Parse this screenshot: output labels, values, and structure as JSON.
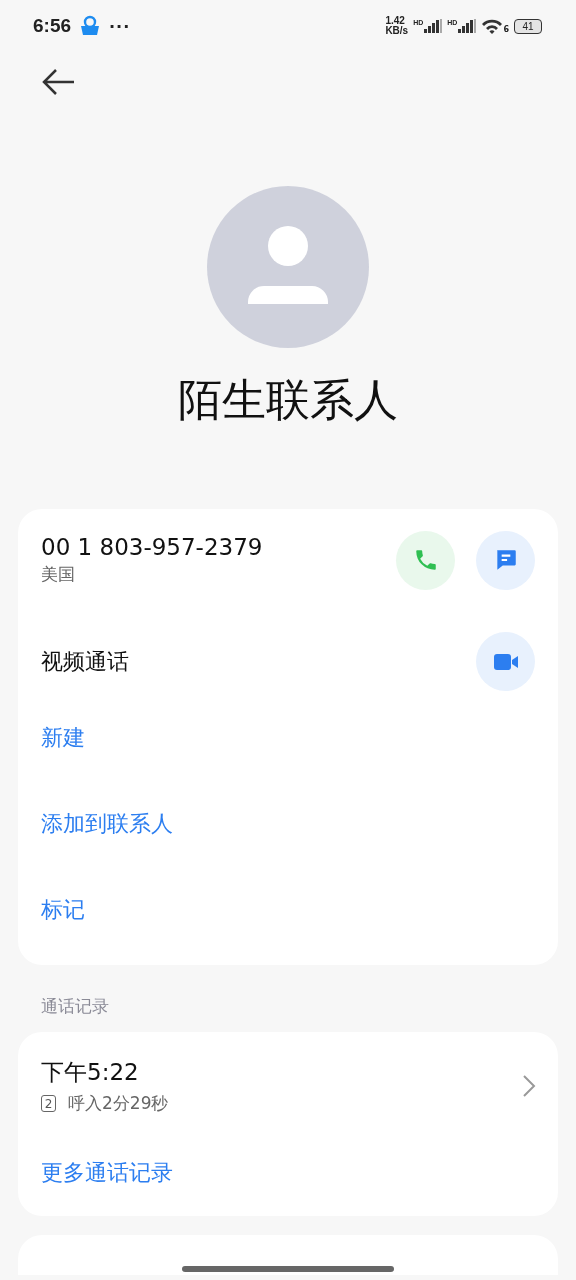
{
  "status_bar": {
    "time": "6:56",
    "more": "···",
    "net_speed": [
      "1.42",
      "KB/s"
    ],
    "signals": [
      {
        "label": "HD"
      },
      {
        "label": "HD"
      }
    ],
    "wifi_label": "6",
    "battery": "41"
  },
  "contact": {
    "name": "陌生联系人"
  },
  "details": [
    {
      "kind": "phone",
      "number": "00 1 803-957-2379",
      "region": "美国"
    },
    {
      "kind": "video",
      "label": "视频通话"
    },
    {
      "kind": "link",
      "label": "新建"
    },
    {
      "kind": "link",
      "label": "添加到联系人"
    },
    {
      "kind": "link",
      "label": "标记"
    }
  ],
  "call_log": {
    "heading": "通话记录",
    "entries": [
      {
        "time": "下午5:22",
        "sim": "2",
        "detail": "呼入2分29秒"
      }
    ],
    "more": "更多通话记录"
  }
}
